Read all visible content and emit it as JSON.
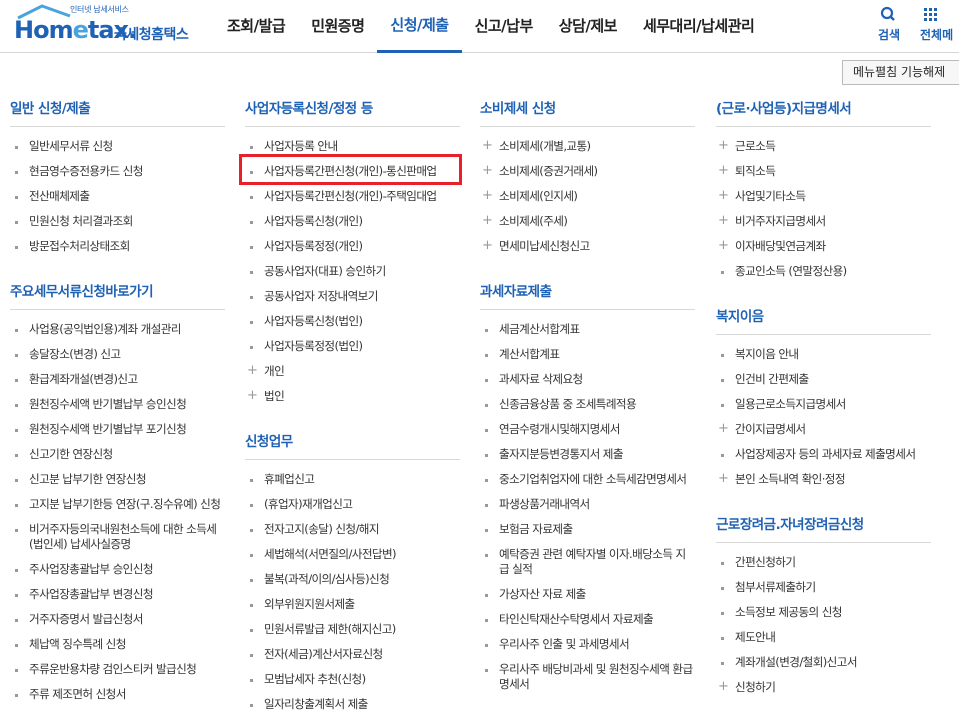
{
  "header": {
    "logo_sub": "인터넷 납세서비스",
    "logo_main_a": "Hom",
    "logo_main_e": "e",
    "logo_main_b": "tax.",
    "logo_kr": "국세청홈택스",
    "nav": [
      {
        "label": "조회/발급"
      },
      {
        "label": "민원증명"
      },
      {
        "label": "신청/제출"
      },
      {
        "label": "신고/납부"
      },
      {
        "label": "상담/제보"
      },
      {
        "label": "세무대리/납세관리"
      }
    ],
    "search_label": "검색",
    "all_label": "전체메"
  },
  "fold_button": "메뉴펼침 기능해제",
  "columns": [
    {
      "sections": [
        {
          "title": "일반 신청/제출",
          "items": [
            "일반세무서류 신청",
            "현금영수증전용카드 신청",
            "전산매체제출",
            "민원신청 처리결과조회",
            "방문접수처리상태조회"
          ]
        },
        {
          "title": "주요세무서류신청바로가기",
          "items": [
            "사업용(공익법인용)계좌 개설관리",
            "송달장소(변경) 신고",
            "환급계좌개설(변경)신고",
            "원천징수세액 반기별납부 승인신청",
            "원천징수세액 반기별납부 포기신청",
            "신고기한 연장신청",
            "신고분 납부기한 연장신청",
            "고지분 납부기한등 연장(구.징수유예) 신청",
            "비거주자등의국내원천소득에 대한 소득세(법인세) 납세사실증명",
            "주사업장총괄납부 승인신청",
            "주사업장총괄납부 변경신청",
            "거주자증명서 발급신청서",
            "체납액 징수특례 신청",
            "주류운반용차량 검인스티커 발급신청",
            "주류 제조면허 신청서"
          ]
        }
      ]
    },
    {
      "sections": [
        {
          "title": "사업자등록신청/정정 등",
          "items": [
            "사업자등록 안내",
            "사업자등록간편신청(개인)-통신판매업",
            "사업자등록간편신청(개인)-주택임대업",
            "사업자등록신청(개인)",
            "사업자등록정정(개인)",
            "공동사업자(대표) 승인하기",
            "공동사업자 저장내역보기",
            "사업자등록신청(법인)",
            "사업자등록정정(법인)"
          ],
          "plus_items": [
            "개인",
            "법인"
          ]
        },
        {
          "title": "신청업무",
          "items": [
            "휴폐업신고",
            "(휴업자)재개업신고",
            "전자고지(송달) 신청/해지",
            "세법해석(서면질의/사전답변)",
            "불복(과적/이의/심사등)신청",
            "외부위원지원서제출",
            "민원서류발급 제한(해지신고)",
            "전자(세금)계산서자료신청",
            "모범납세자 추천(신청)",
            "일자리창출계획서 제출"
          ]
        }
      ]
    },
    {
      "sections": [
        {
          "title": "소비제세 신청",
          "plus_items": [
            "소비제세(개별,교통)",
            "소비제세(증권거래세)",
            "소비제세(인지세)",
            "소비제세(주세)",
            "면세미납세신청신고"
          ]
        },
        {
          "title": "과세자료제출",
          "items": [
            "세금계산서합계표",
            "계산서합계표",
            "과세자료 삭제요청",
            "신종금융상품 중 조세특례적용",
            "연금수령개시및해지명세서",
            "출자지분등변경통지서 제출",
            "중소기업취업자에 대한 소득세감면명세서",
            "파생상품거래내역서",
            "보험금 자료제출",
            "예탁증권 관련 예탁자별 이자.배당소득 지급 실적",
            "가상자산 자료 제출",
            "타인신탁재산수탁명세서 자료제출",
            "우리사주 인출 및 과세명세서",
            "우리사주 배당비과세 및 원천징수세액 환급명세서"
          ]
        }
      ]
    },
    {
      "sections": [
        {
          "title": "(근로·사업등)지급명세서",
          "plus_items": [
            "근로소득",
            "퇴직소득",
            "사업및기타소득",
            "비거주자지급명세서",
            "이자배당및연금계좌"
          ],
          "items": [
            "종교인소득 (연말정산용)"
          ]
        },
        {
          "title": "복지이음",
          "items": [
            "복지이음 안내",
            "인건비 간편제출",
            "일용근로소득지급명세서"
          ],
          "plus_items": [
            "간이지급명세서"
          ],
          "items2": [
            "사업장제공자 등의 과세자료 제출명세서"
          ],
          "plus_items2": [
            "본인 소득내역 확인·정정"
          ]
        },
        {
          "title": "근로장려금.자녀장려금신청",
          "items": [
            "간편신청하기",
            "첨부서류제출하기",
            "소득정보 제공동의 신청",
            "제도안내",
            "계좌개설(변경/철회)신고서"
          ],
          "plus_items": [
            "신청하기"
          ]
        }
      ]
    }
  ]
}
